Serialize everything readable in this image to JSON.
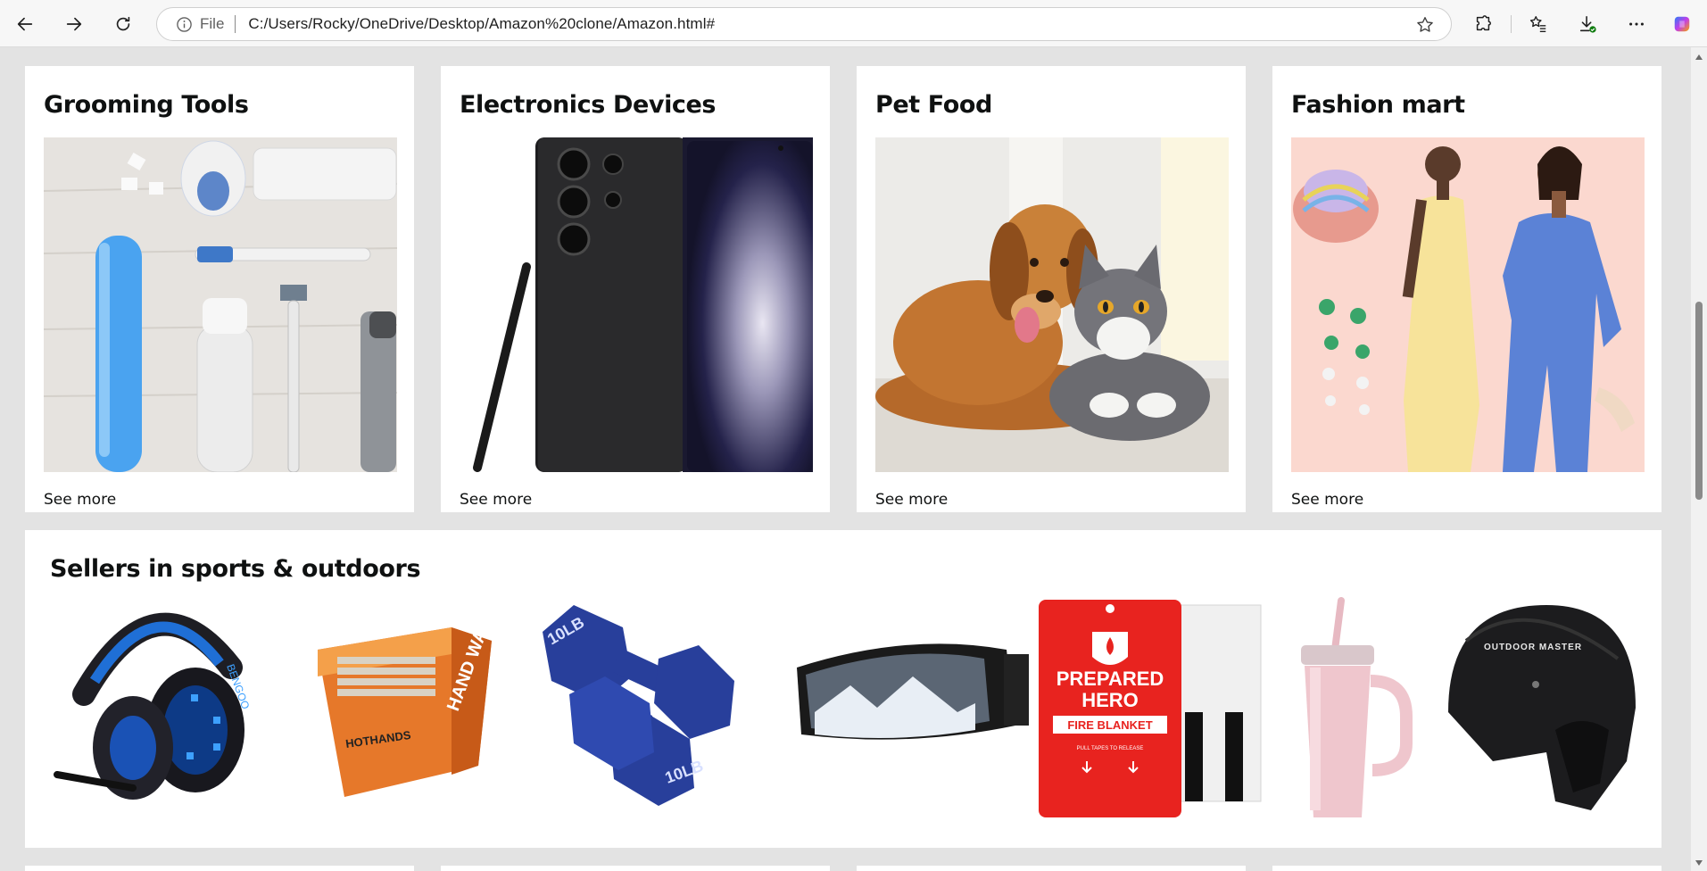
{
  "browser": {
    "address_prefix": "File",
    "url": "C:/Users/Rocky/OneDrive/Desktop/Amazon%20clone/Amazon.html#"
  },
  "cards": [
    {
      "title": "Grooming Tools",
      "link": "See more"
    },
    {
      "title": "Electronics Devices",
      "link": "See more"
    },
    {
      "title": "Pet Food",
      "link": "See more"
    },
    {
      "title": "Fashion mart",
      "link": "See more"
    }
  ],
  "sports": {
    "title": "Sellers in sports & outdoors",
    "products": [
      {
        "icon": "gaming-headset-image",
        "brand_text": "BENGOO"
      },
      {
        "icon": "hand-warmers-box-image",
        "brand_text": "HAND WARMERS",
        "sub_text": "HOTHANDS"
      },
      {
        "icon": "dumbbells-image",
        "label_text": "10LB"
      },
      {
        "icon": "ski-goggles-image"
      },
      {
        "icon": "fire-blanket-image",
        "line1": "PREPARED",
        "line2": "HERO",
        "line3": "FIRE BLANKET",
        "line4": "PULL TAPES TO RELEASE"
      },
      {
        "icon": "tumbler-image"
      },
      {
        "icon": "ski-helmet-image",
        "brand_text": "OUTDOOR MASTER"
      }
    ]
  }
}
